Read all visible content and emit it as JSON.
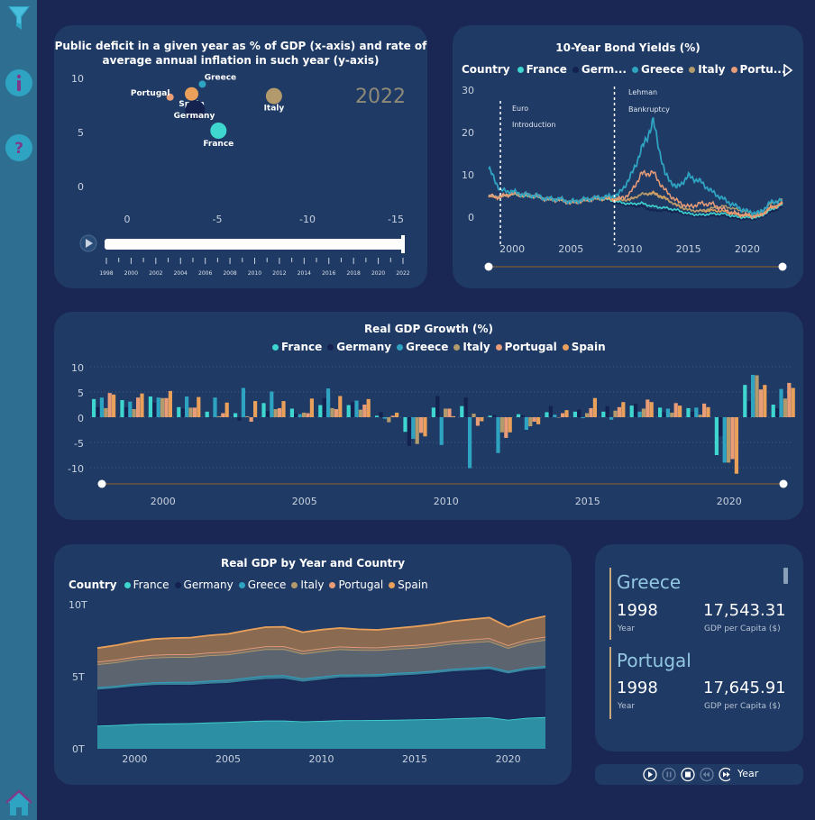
{
  "sidebar": {
    "items": [
      {
        "icon": "filter-icon"
      },
      {
        "icon": "info-icon"
      },
      {
        "icon": "help-icon"
      },
      {
        "icon": "home-icon"
      }
    ]
  },
  "colors": {
    "france": "#3fd6d0",
    "germany": "#14224f",
    "greece": "#2fa3c2",
    "italy": "#b39a6c",
    "portugal": "#e89c78",
    "spain": "#e8a05a",
    "card": "#1f3a64",
    "bg": "#1a2654"
  },
  "bubble": {
    "title_line1": "Public deficit in a given year as % of GDP (x-axis) and rate of",
    "title_line2": "average annual inflation in such year (y-axis)",
    "year_label": "2022",
    "y_ticks": [
      "10",
      "5",
      "0"
    ],
    "x_ticks": [
      "0",
      "-5",
      "-10",
      "-15"
    ],
    "slider_ticks": [
      "1998",
      "2000",
      "2002",
      "2004",
      "2006",
      "2008",
      "2010",
      "2012",
      "2014",
      "2016",
      "2018",
      "2020",
      "2022"
    ],
    "points": [
      {
        "name": "Portugal",
        "x": -2.4,
        "y": 8.1,
        "size": 6,
        "color": "#e89c78"
      },
      {
        "name": "Greece",
        "x": -4.2,
        "y": 9.3,
        "size": 6,
        "color": "#2fa3c2"
      },
      {
        "name": "Spain",
        "x": -3.6,
        "y": 8.4,
        "size": 13,
        "color": "#e8a05a"
      },
      {
        "name": "Germany",
        "x": -3.8,
        "y": 6.9,
        "size": 20,
        "color": "#14224f"
      },
      {
        "name": "Italy",
        "x": -8.2,
        "y": 8.2,
        "size": 16,
        "color": "#b39a6c"
      },
      {
        "name": "France",
        "x": -5.1,
        "y": 5.0,
        "size": 16,
        "color": "#3fd6d0"
      }
    ]
  },
  "bonds": {
    "title": "10-Year Bond Yields (%)",
    "legend_title": "Country",
    "legend": [
      {
        "name": "France",
        "color": "#3fd6d0"
      },
      {
        "name": "Germ...",
        "color": "#14224f"
      },
      {
        "name": "Greece",
        "color": "#2fa3c2"
      },
      {
        "name": "Italy",
        "color": "#b39a6c"
      },
      {
        "name": "Portu...",
        "color": "#e89c78"
      }
    ],
    "y_ticks": [
      "30",
      "20",
      "10",
      "0"
    ],
    "x_ticks": [
      "2000",
      "2005",
      "2010",
      "2015",
      "2020"
    ],
    "annotation1_l1": "Euro",
    "annotation1_l2": "Introduction",
    "annotation2_l1": "Lehman",
    "annotation2_l2": "Bankruptcy"
  },
  "growth": {
    "title": "Real GDP Growth (%)",
    "legend": [
      {
        "name": "France",
        "color": "#3fd6d0"
      },
      {
        "name": "Germany",
        "color": "#14224f"
      },
      {
        "name": "Greece",
        "color": "#2fa3c2"
      },
      {
        "name": "Italy",
        "color": "#b39a6c"
      },
      {
        "name": "Portugal",
        "color": "#e89c78"
      },
      {
        "name": "Spain",
        "color": "#e8a05a"
      }
    ],
    "y_ticks": [
      "10",
      "5",
      "0",
      "-5",
      "-10"
    ],
    "x_ticks": [
      "2000",
      "2005",
      "2010",
      "2015",
      "2020"
    ]
  },
  "area": {
    "title": "Real GDP by Year and Country",
    "legend_title": "Country",
    "legend": [
      {
        "name": "France",
        "color": "#3fd6d0"
      },
      {
        "name": "Germany",
        "color": "#14224f"
      },
      {
        "name": "Greece",
        "color": "#2fa3c2"
      },
      {
        "name": "Italy",
        "color": "#b39a6c"
      },
      {
        "name": "Portugal",
        "color": "#e89c78"
      },
      {
        "name": "Spain",
        "color": "#e8a05a"
      }
    ],
    "y_ticks": [
      "10T",
      "5T",
      "0T"
    ],
    "x_ticks": [
      "2000",
      "2005",
      "2010",
      "2015",
      "2020"
    ]
  },
  "kpi": [
    {
      "country": "Greece",
      "year": "1998",
      "year_label": "Year",
      "value": "17,543.31",
      "value_label": "GDP per Capita ($)"
    },
    {
      "country": "Portugal",
      "year": "1998",
      "year_label": "Year",
      "value": "17,645.91",
      "value_label": "GDP per Capita ($)"
    }
  ],
  "player": {
    "label": "Year"
  },
  "chart_data": [
    {
      "type": "scatter",
      "title": "Public deficit in a given year as % of GDP (x-axis) and rate of average annual inflation in such year (y-axis)",
      "xlim": [
        0,
        -15
      ],
      "ylim": [
        0,
        10
      ],
      "year": "2022",
      "points": [
        {
          "name": "Portugal",
          "x": -2.4,
          "y": 8.1
        },
        {
          "name": "Greece",
          "x": -4.2,
          "y": 9.3
        },
        {
          "name": "Spain",
          "x": -3.6,
          "y": 8.4
        },
        {
          "name": "Germany",
          "x": -3.8,
          "y": 6.9
        },
        {
          "name": "Italy",
          "x": -8.2,
          "y": 8.2
        },
        {
          "name": "France",
          "x": -5.1,
          "y": 5.0
        }
      ]
    },
    {
      "type": "line",
      "title": "10-Year Bond Yields (%)",
      "x": [
        1998,
        1999,
        2000,
        2001,
        2002,
        2003,
        2004,
        2005,
        2006,
        2007,
        2008,
        2009,
        2010,
        2011,
        2012,
        2013,
        2014,
        2015,
        2016,
        2017,
        2018,
        2019,
        2020,
        2021,
        2022,
        2023
      ],
      "ylim": [
        0,
        30
      ],
      "series": [
        {
          "name": "France",
          "values": [
            5.0,
            4.8,
            5.4,
            4.9,
            4.8,
            4.1,
            4.1,
            3.4,
            3.8,
            4.3,
            4.2,
            3.6,
            3.1,
            3.3,
            2.5,
            2.2,
            1.7,
            0.8,
            0.5,
            0.8,
            0.8,
            0.1,
            -0.1,
            0.0,
            1.7,
            3.0
          ]
        },
        {
          "name": "Germany",
          "values": [
            4.6,
            4.5,
            5.3,
            4.8,
            4.8,
            4.1,
            4.0,
            3.4,
            3.8,
            4.2,
            4.0,
            3.2,
            2.7,
            2.6,
            1.5,
            1.6,
            1.2,
            0.5,
            0.1,
            0.3,
            0.4,
            -0.3,
            -0.5,
            -0.3,
            1.2,
            2.5
          ]
        },
        {
          "name": "Greece",
          "values": [
            11.5,
            6.3,
            6.1,
            5.3,
            5.1,
            4.3,
            4.3,
            3.6,
            4.1,
            4.5,
            4.8,
            5.2,
            9.1,
            15.8,
            22.5,
            10.1,
            6.9,
            9.7,
            8.4,
            6.0,
            4.2,
            2.6,
            1.3,
            0.9,
            3.5,
            4.0
          ]
        },
        {
          "name": "Italy",
          "values": [
            4.9,
            4.7,
            5.6,
            5.2,
            5.0,
            4.3,
            4.3,
            3.6,
            4.0,
            4.5,
            4.7,
            4.3,
            4.0,
            5.4,
            5.5,
            4.3,
            2.9,
            1.7,
            1.5,
            2.1,
            2.6,
            1.9,
            1.2,
            0.8,
            3.2,
            4.3
          ]
        },
        {
          "name": "Portugal",
          "values": [
            4.9,
            4.8,
            5.6,
            5.2,
            5.0,
            4.2,
            4.1,
            3.4,
            3.9,
            4.4,
            4.5,
            4.2,
            5.4,
            10.2,
            10.5,
            6.3,
            3.8,
            2.4,
            3.2,
            3.1,
            1.8,
            0.8,
            0.4,
            0.3,
            2.2,
            3.2
          ]
        },
        {
          "name": "Spain",
          "values": [
            4.8,
            4.7,
            5.5,
            5.1,
            5.0,
            4.1,
            4.1,
            3.4,
            3.8,
            4.3,
            4.4,
            4.0,
            4.2,
            5.4,
            5.8,
            4.6,
            2.7,
            1.7,
            1.4,
            1.6,
            1.4,
            0.7,
            0.4,
            0.3,
            2.2,
            3.3
          ]
        }
      ],
      "annotations": [
        {
          "text": "Euro Introduction",
          "x": 1999
        },
        {
          "text": "Lehman Bankruptcy",
          "x": 2008.7
        }
      ]
    },
    {
      "type": "bar",
      "title": "Real GDP Growth (%)",
      "categories": [
        1998,
        1999,
        2000,
        2001,
        2002,
        2003,
        2004,
        2005,
        2006,
        2007,
        2008,
        2009,
        2010,
        2011,
        2012,
        2013,
        2014,
        2015,
        2016,
        2017,
        2018,
        2019,
        2020,
        2021,
        2022
      ],
      "ylim": [
        -10,
        10
      ],
      "series": [
        {
          "name": "France",
          "values": [
            3.6,
            3.4,
            4.1,
            2.0,
            1.1,
            0.8,
            2.8,
            1.7,
            2.4,
            2.4,
            0.3,
            -2.9,
            1.9,
            2.2,
            0.3,
            0.6,
            1.0,
            1.1,
            1.1,
            2.3,
            1.9,
            1.8,
            -7.5,
            6.4,
            2.5
          ]
        },
        {
          "name": "Germany",
          "values": [
            2.0,
            2.0,
            2.9,
            1.7,
            0.0,
            -0.7,
            1.2,
            0.7,
            3.8,
            3.0,
            1.0,
            -5.7,
            4.2,
            3.9,
            0.4,
            0.4,
            2.2,
            1.5,
            2.2,
            2.7,
            1.0,
            1.1,
            -3.8,
            3.2,
            1.8
          ]
        },
        {
          "name": "Greece",
          "values": [
            3.9,
            3.1,
            3.9,
            4.1,
            3.9,
            5.8,
            5.1,
            0.6,
            5.7,
            3.3,
            -0.3,
            -4.3,
            -5.5,
            -10.1,
            -7.1,
            -2.5,
            0.5,
            -0.2,
            -0.5,
            1.1,
            1.7,
            1.9,
            -9.0,
            8.4,
            5.6
          ]
        },
        {
          "name": "Italy",
          "values": [
            1.8,
            1.6,
            3.8,
            1.9,
            0.2,
            0.2,
            1.6,
            0.9,
            1.8,
            1.5,
            -1.0,
            -5.3,
            1.7,
            0.7,
            -3.0,
            -1.8,
            0.0,
            0.8,
            1.3,
            1.7,
            0.9,
            0.5,
            -9.0,
            8.3,
            3.7
          ]
        },
        {
          "name": "Portugal",
          "values": [
            4.8,
            3.9,
            3.8,
            1.9,
            0.8,
            -0.9,
            1.8,
            0.8,
            1.6,
            2.5,
            0.3,
            -3.1,
            1.7,
            -1.7,
            -4.1,
            -0.9,
            0.8,
            1.8,
            2.0,
            3.5,
            2.8,
            2.7,
            -8.3,
            5.5,
            6.8
          ]
        },
        {
          "name": "Spain",
          "values": [
            4.5,
            4.7,
            5.2,
            4.0,
            2.9,
            3.2,
            3.2,
            3.7,
            4.2,
            3.6,
            0.9,
            -3.8,
            0.2,
            -0.8,
            -3.0,
            -1.4,
            1.4,
            3.8,
            3.0,
            3.0,
            2.3,
            2.0,
            -11.2,
            6.4,
            5.8
          ]
        }
      ]
    },
    {
      "type": "area",
      "title": "Real GDP by Year and Country",
      "x": [
        1998,
        1999,
        2000,
        2001,
        2002,
        2003,
        2004,
        2005,
        2006,
        2007,
        2008,
        2009,
        2010,
        2011,
        2012,
        2013,
        2014,
        2015,
        2016,
        2017,
        2018,
        2019,
        2020,
        2021,
        2022
      ],
      "ylim": [
        0,
        10
      ],
      "yunit": "T",
      "series": [
        {
          "name": "France",
          "values": [
            1.6,
            1.65,
            1.72,
            1.75,
            1.77,
            1.78,
            1.83,
            1.86,
            1.91,
            1.96,
            1.96,
            1.9,
            1.94,
            1.98,
            1.99,
            2.0,
            2.02,
            2.04,
            2.06,
            2.11,
            2.15,
            2.19,
            2.02,
            2.15,
            2.2
          ]
        },
        {
          "name": "Germany",
          "values": [
            2.5,
            2.55,
            2.62,
            2.67,
            2.67,
            2.65,
            2.68,
            2.7,
            2.8,
            2.88,
            2.91,
            2.75,
            2.86,
            2.97,
            2.98,
            2.99,
            3.06,
            3.1,
            3.17,
            3.26,
            3.29,
            3.32,
            3.2,
            3.3,
            3.36
          ]
        },
        {
          "name": "Greece",
          "values": [
            0.17,
            0.17,
            0.18,
            0.19,
            0.2,
            0.21,
            0.22,
            0.22,
            0.23,
            0.24,
            0.24,
            0.23,
            0.22,
            0.2,
            0.18,
            0.18,
            0.18,
            0.18,
            0.18,
            0.18,
            0.18,
            0.19,
            0.17,
            0.18,
            0.19
          ]
        },
        {
          "name": "Italy",
          "values": [
            1.6,
            1.63,
            1.69,
            1.72,
            1.73,
            1.73,
            1.76,
            1.77,
            1.8,
            1.83,
            1.81,
            1.72,
            1.75,
            1.76,
            1.71,
            1.68,
            1.68,
            1.69,
            1.71,
            1.74,
            1.76,
            1.77,
            1.61,
            1.74,
            1.81
          ]
        },
        {
          "name": "Portugal",
          "values": [
            0.17,
            0.18,
            0.18,
            0.19,
            0.19,
            0.19,
            0.19,
            0.19,
            0.2,
            0.2,
            0.2,
            0.2,
            0.2,
            0.19,
            0.19,
            0.18,
            0.19,
            0.19,
            0.19,
            0.2,
            0.21,
            0.21,
            0.19,
            0.21,
            0.22
          ]
        },
        {
          "name": "Spain",
          "values": [
            0.95,
            1.0,
            1.05,
            1.09,
            1.12,
            1.15,
            1.19,
            1.23,
            1.28,
            1.33,
            1.34,
            1.29,
            1.29,
            1.28,
            1.24,
            1.22,
            1.24,
            1.28,
            1.32,
            1.36,
            1.39,
            1.42,
            1.26,
            1.34,
            1.42
          ]
        }
      ]
    }
  ]
}
